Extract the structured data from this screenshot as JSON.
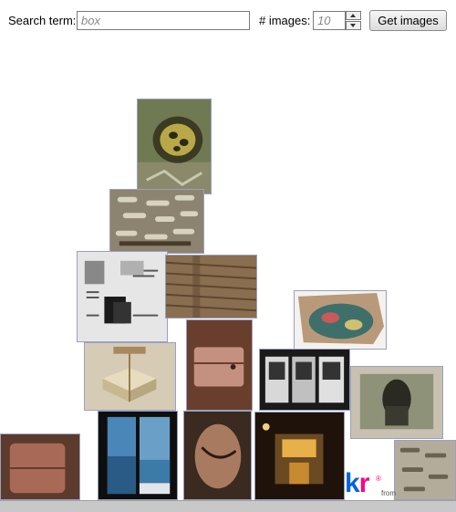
{
  "toolbar": {
    "search_label": "Search term:",
    "search_placeholder": "box",
    "count_label": "# images:",
    "count_placeholder": "10",
    "submit_label": "Get images"
  },
  "photos": [
    {
      "subject": "tortoise in grass",
      "icon": "tortoise-photo"
    },
    {
      "subject": "box of bolts",
      "icon": "bolts-photo"
    },
    {
      "subject": "product box diagram",
      "icon": "product-box-photo"
    },
    {
      "subject": "cardboard close-up",
      "icon": "cardboard-photo"
    },
    {
      "subject": "open box with cloth",
      "icon": "open-box-photo"
    },
    {
      "subject": "wrapped gift box",
      "icon": "gift-box-photo"
    },
    {
      "subject": "leather pouch",
      "icon": "leather-pouch-photo"
    },
    {
      "subject": "vending machines",
      "icon": "vending-photo"
    },
    {
      "subject": "framed portrait",
      "icon": "portrait-photo"
    },
    {
      "subject": "leather wallet",
      "icon": "wallet-photo"
    },
    {
      "subject": "sea panorama",
      "icon": "sea-photo"
    },
    {
      "subject": "tied leather cord",
      "icon": "cord-photo"
    },
    {
      "subject": "night street scene",
      "icon": "night-street-photo"
    },
    {
      "subject": "pile of bolts",
      "icon": "bolts-pile-photo"
    }
  ],
  "branding": {
    "logo_main": "k",
    "logo_accent": "r",
    "registered": "®",
    "from_text": "from"
  },
  "colors": {
    "flickr_blue": "#0063dc",
    "flickr_pink": "#ff0084"
  }
}
